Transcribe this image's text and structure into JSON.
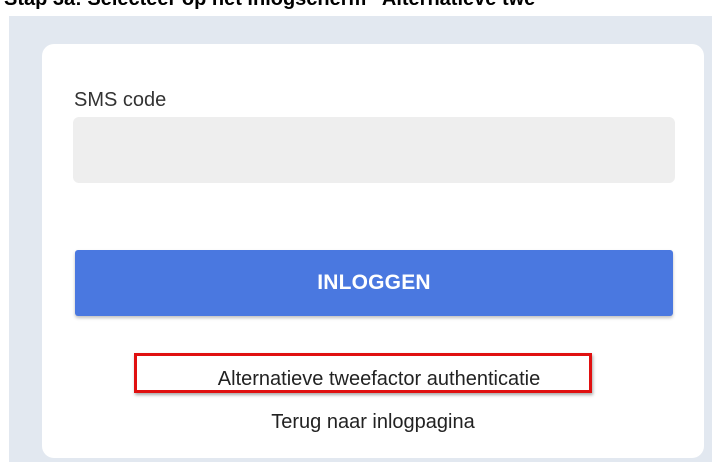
{
  "caption": "Stap 3a: Selecteer op het inlogscherm “Alternatieve twe",
  "form": {
    "sms_label": "SMS code",
    "sms_value": "",
    "sms_placeholder": "",
    "login_button": "INLOGGEN",
    "alternative_link": "Alternatieve tweefactor authenticatie",
    "back_link": "Terug naar inlogpagina"
  },
  "colors": {
    "button": "#4a78e0",
    "highlight_border": "#e01010",
    "background": "#e2e8f0",
    "card": "#ffffff"
  }
}
